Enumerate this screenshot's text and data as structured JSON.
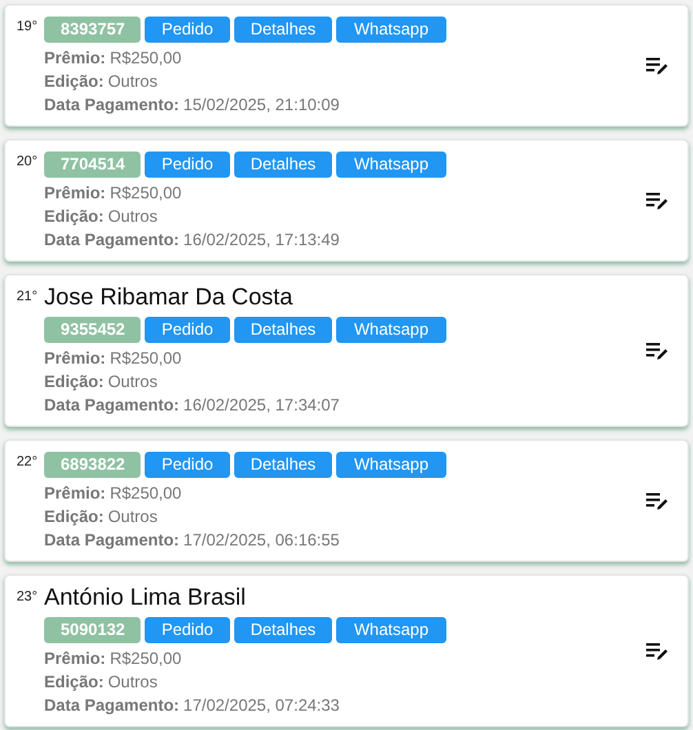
{
  "entries": [
    {
      "rank": "19°",
      "code": "8393757",
      "actions": [
        "Pedido",
        "Detalhes",
        "Whatsapp"
      ],
      "fields": [
        {
          "label": "Prêmio:",
          "value": "R$250,00"
        },
        {
          "label": "Edição:",
          "value": "Outros"
        },
        {
          "label": "Data Pagamento:",
          "value": "15/02/2025, 21:10:09"
        }
      ]
    },
    {
      "rank": "20°",
      "code": "7704514",
      "actions": [
        "Pedido",
        "Detalhes",
        "Whatsapp"
      ],
      "fields": [
        {
          "label": "Prêmio:",
          "value": "R$250,00"
        },
        {
          "label": "Edição:",
          "value": "Outros"
        },
        {
          "label": "Data Pagamento:",
          "value": "16/02/2025, 17:13:49"
        }
      ]
    },
    {
      "rank": "21°",
      "name": "Jose Ribamar Da Costa",
      "code": "9355452",
      "actions": [
        "Pedido",
        "Detalhes",
        "Whatsapp"
      ],
      "fields": [
        {
          "label": "Prêmio:",
          "value": "R$250,00"
        },
        {
          "label": "Edição:",
          "value": "Outros"
        },
        {
          "label": "Data Pagamento:",
          "value": "16/02/2025, 17:34:07"
        }
      ]
    },
    {
      "rank": "22°",
      "code": "6893822",
      "actions": [
        "Pedido",
        "Detalhes",
        "Whatsapp"
      ],
      "fields": [
        {
          "label": "Prêmio:",
          "value": "R$250,00"
        },
        {
          "label": "Edição:",
          "value": "Outros"
        },
        {
          "label": "Data Pagamento:",
          "value": "17/02/2025, 06:16:55"
        }
      ]
    },
    {
      "rank": "23°",
      "name": "António Lima Brasil",
      "code": "5090132",
      "actions": [
        "Pedido",
        "Detalhes",
        "Whatsapp"
      ],
      "fields": [
        {
          "label": "Prêmio:",
          "value": "R$250,00"
        },
        {
          "label": "Edição:",
          "value": "Outros"
        },
        {
          "label": "Data Pagamento:",
          "value": "17/02/2025, 07:24:33"
        }
      ]
    }
  ]
}
